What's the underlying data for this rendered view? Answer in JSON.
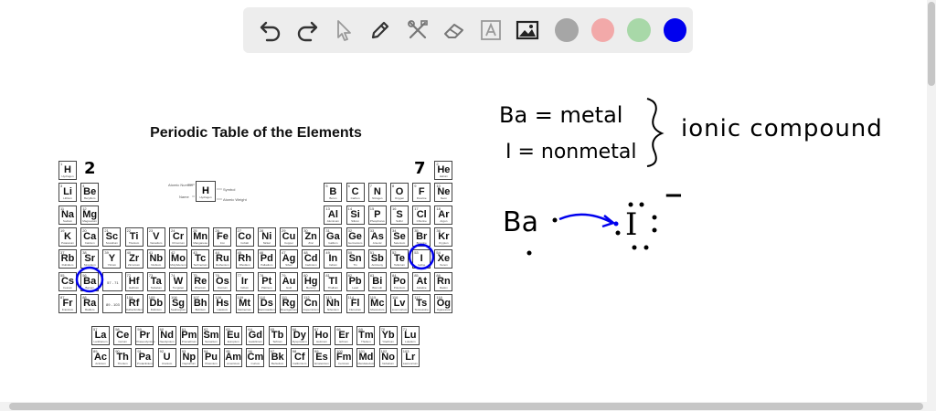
{
  "toolbar": {
    "tools": [
      {
        "name": "undo-button",
        "icon": "undo-icon"
      },
      {
        "name": "redo-button",
        "icon": "redo-icon"
      },
      {
        "name": "select-button",
        "icon": "pointer-icon"
      },
      {
        "name": "pen-button",
        "icon": "pen-icon"
      },
      {
        "name": "tools-button",
        "icon": "tools-icon"
      },
      {
        "name": "eraser-button",
        "icon": "eraser-icon"
      },
      {
        "name": "text-button",
        "icon": "text-icon"
      },
      {
        "name": "image-button",
        "icon": "image-icon"
      }
    ],
    "colors": [
      "#a6a6a6",
      "#f2a9a9",
      "#a8d8a8",
      "#0000ee"
    ]
  },
  "periodic_table": {
    "title": "Periodic Table of the Elements",
    "key": {
      "symbol": "H",
      "name": "Hydrogen",
      "atomic_number_label": "Atomic Number",
      "name_label": "Name",
      "symbol_label": "Symbol",
      "weight_label": "Atomic Weight"
    },
    "elements": [
      {
        "sym": "H",
        "n": "1",
        "nm": "Hydrogen",
        "r": 0,
        "c": 0
      },
      {
        "sym": "He",
        "n": "2",
        "nm": "Helium",
        "r": 0,
        "c": 17
      },
      {
        "sym": "Li",
        "n": "3",
        "nm": "Lithium",
        "r": 1,
        "c": 0
      },
      {
        "sym": "Be",
        "n": "4",
        "nm": "Beryllium",
        "r": 1,
        "c": 1
      },
      {
        "sym": "B",
        "n": "5",
        "nm": "Boron",
        "r": 1,
        "c": 12
      },
      {
        "sym": "C",
        "n": "6",
        "nm": "Carbon",
        "r": 1,
        "c": 13
      },
      {
        "sym": "N",
        "n": "7",
        "nm": "Nitrogen",
        "r": 1,
        "c": 14
      },
      {
        "sym": "O",
        "n": "8",
        "nm": "Oxygen",
        "r": 1,
        "c": 15
      },
      {
        "sym": "F",
        "n": "9",
        "nm": "Fluorine",
        "r": 1,
        "c": 16
      },
      {
        "sym": "Ne",
        "n": "10",
        "nm": "Neon",
        "r": 1,
        "c": 17
      },
      {
        "sym": "Na",
        "n": "11",
        "nm": "Sodium",
        "r": 2,
        "c": 0
      },
      {
        "sym": "Mg",
        "n": "12",
        "nm": "Magnesium",
        "r": 2,
        "c": 1
      },
      {
        "sym": "Al",
        "n": "13",
        "nm": "Aluminum",
        "r": 2,
        "c": 12
      },
      {
        "sym": "Si",
        "n": "14",
        "nm": "Silicon",
        "r": 2,
        "c": 13
      },
      {
        "sym": "P",
        "n": "15",
        "nm": "Phosphorus",
        "r": 2,
        "c": 14
      },
      {
        "sym": "S",
        "n": "16",
        "nm": "Sulfur",
        "r": 2,
        "c": 15
      },
      {
        "sym": "Cl",
        "n": "17",
        "nm": "Chlorine",
        "r": 2,
        "c": 16
      },
      {
        "sym": "Ar",
        "n": "18",
        "nm": "Argon",
        "r": 2,
        "c": 17
      },
      {
        "sym": "K",
        "n": "19",
        "nm": "Potassium",
        "r": 3,
        "c": 0
      },
      {
        "sym": "Ca",
        "n": "20",
        "nm": "Calcium",
        "r": 3,
        "c": 1
      },
      {
        "sym": "Sc",
        "n": "21",
        "nm": "Scandium",
        "r": 3,
        "c": 2
      },
      {
        "sym": "Ti",
        "n": "22",
        "nm": "Titanium",
        "r": 3,
        "c": 3
      },
      {
        "sym": "V",
        "n": "23",
        "nm": "Vanadium",
        "r": 3,
        "c": 4
      },
      {
        "sym": "Cr",
        "n": "24",
        "nm": "Chromium",
        "r": 3,
        "c": 5
      },
      {
        "sym": "Mn",
        "n": "25",
        "nm": "Manganese",
        "r": 3,
        "c": 6
      },
      {
        "sym": "Fe",
        "n": "26",
        "nm": "Iron",
        "r": 3,
        "c": 7
      },
      {
        "sym": "Co",
        "n": "27",
        "nm": "Cobalt",
        "r": 3,
        "c": 8
      },
      {
        "sym": "Ni",
        "n": "28",
        "nm": "Nickel",
        "r": 3,
        "c": 9
      },
      {
        "sym": "Cu",
        "n": "29",
        "nm": "Copper",
        "r": 3,
        "c": 10
      },
      {
        "sym": "Zn",
        "n": "30",
        "nm": "Zinc",
        "r": 3,
        "c": 11
      },
      {
        "sym": "Ga",
        "n": "31",
        "nm": "Gallium",
        "r": 3,
        "c": 12
      },
      {
        "sym": "Ge",
        "n": "32",
        "nm": "Germanium",
        "r": 3,
        "c": 13
      },
      {
        "sym": "As",
        "n": "33",
        "nm": "Arsenic",
        "r": 3,
        "c": 14
      },
      {
        "sym": "Se",
        "n": "34",
        "nm": "Selenium",
        "r": 3,
        "c": 15
      },
      {
        "sym": "Br",
        "n": "35",
        "nm": "Bromine",
        "r": 3,
        "c": 16
      },
      {
        "sym": "Kr",
        "n": "36",
        "nm": "Krypton",
        "r": 3,
        "c": 17
      },
      {
        "sym": "Rb",
        "n": "37",
        "nm": "Rubidium",
        "r": 4,
        "c": 0
      },
      {
        "sym": "Sr",
        "n": "38",
        "nm": "Strontium",
        "r": 4,
        "c": 1
      },
      {
        "sym": "Y",
        "n": "39",
        "nm": "Yttrium",
        "r": 4,
        "c": 2
      },
      {
        "sym": "Zr",
        "n": "40",
        "nm": "Zirconium",
        "r": 4,
        "c": 3
      },
      {
        "sym": "Nb",
        "n": "41",
        "nm": "Niobium",
        "r": 4,
        "c": 4
      },
      {
        "sym": "Mo",
        "n": "42",
        "nm": "Molybdenum",
        "r": 4,
        "c": 5
      },
      {
        "sym": "Tc",
        "n": "43",
        "nm": "Technetium",
        "r": 4,
        "c": 6
      },
      {
        "sym": "Ru",
        "n": "44",
        "nm": "Ruthenium",
        "r": 4,
        "c": 7
      },
      {
        "sym": "Rh",
        "n": "45",
        "nm": "Rhodium",
        "r": 4,
        "c": 8
      },
      {
        "sym": "Pd",
        "n": "46",
        "nm": "Palladium",
        "r": 4,
        "c": 9
      },
      {
        "sym": "Ag",
        "n": "47",
        "nm": "Silver",
        "r": 4,
        "c": 10
      },
      {
        "sym": "Cd",
        "n": "48",
        "nm": "Cadmium",
        "r": 4,
        "c": 11
      },
      {
        "sym": "In",
        "n": "49",
        "nm": "Indium",
        "r": 4,
        "c": 12
      },
      {
        "sym": "Sn",
        "n": "50",
        "nm": "Tin",
        "r": 4,
        "c": 13
      },
      {
        "sym": "Sb",
        "n": "51",
        "nm": "Antimony",
        "r": 4,
        "c": 14
      },
      {
        "sym": "Te",
        "n": "52",
        "nm": "Tellurium",
        "r": 4,
        "c": 15
      },
      {
        "sym": "I",
        "n": "53",
        "nm": "Iodine",
        "r": 4,
        "c": 16
      },
      {
        "sym": "Xe",
        "n": "54",
        "nm": "Xenon",
        "r": 4,
        "c": 17
      },
      {
        "sym": "Cs",
        "n": "55",
        "nm": "Cesium",
        "r": 5,
        "c": 0
      },
      {
        "sym": "Ba",
        "n": "56",
        "nm": "Barium",
        "r": 5,
        "c": 1
      },
      {
        "sym": "Hf",
        "n": "72",
        "nm": "Hafnium",
        "r": 5,
        "c": 3
      },
      {
        "sym": "Ta",
        "n": "73",
        "nm": "Tantalum",
        "r": 5,
        "c": 4
      },
      {
        "sym": "W",
        "n": "74",
        "nm": "Tungsten",
        "r": 5,
        "c": 5
      },
      {
        "sym": "Re",
        "n": "75",
        "nm": "Rhenium",
        "r": 5,
        "c": 6
      },
      {
        "sym": "Os",
        "n": "76",
        "nm": "Osmium",
        "r": 5,
        "c": 7
      },
      {
        "sym": "Ir",
        "n": "77",
        "nm": "Iridium",
        "r": 5,
        "c": 8
      },
      {
        "sym": "Pt",
        "n": "78",
        "nm": "Platinum",
        "r": 5,
        "c": 9
      },
      {
        "sym": "Au",
        "n": "79",
        "nm": "Gold",
        "r": 5,
        "c": 10
      },
      {
        "sym": "Hg",
        "n": "80",
        "nm": "Mercury",
        "r": 5,
        "c": 11
      },
      {
        "sym": "Tl",
        "n": "81",
        "nm": "Thallium",
        "r": 5,
        "c": 12
      },
      {
        "sym": "Pb",
        "n": "82",
        "nm": "Lead",
        "r": 5,
        "c": 13
      },
      {
        "sym": "Bi",
        "n": "83",
        "nm": "Bismuth",
        "r": 5,
        "c": 14
      },
      {
        "sym": "Po",
        "n": "84",
        "nm": "Polonium",
        "r": 5,
        "c": 15
      },
      {
        "sym": "At",
        "n": "85",
        "nm": "Astatine",
        "r": 5,
        "c": 16
      },
      {
        "sym": "Rn",
        "n": "86",
        "nm": "Radon",
        "r": 5,
        "c": 17
      },
      {
        "sym": "Fr",
        "n": "87",
        "nm": "Francium",
        "r": 6,
        "c": 0
      },
      {
        "sym": "Ra",
        "n": "88",
        "nm": "Radium",
        "r": 6,
        "c": 1
      },
      {
        "sym": "Rf",
        "n": "104",
        "nm": "Rutherfordium",
        "r": 6,
        "c": 3
      },
      {
        "sym": "Db",
        "n": "105",
        "nm": "Dubnium",
        "r": 6,
        "c": 4
      },
      {
        "sym": "Sg",
        "n": "106",
        "nm": "Seaborgium",
        "r": 6,
        "c": 5
      },
      {
        "sym": "Bh",
        "n": "107",
        "nm": "Bohrium",
        "r": 6,
        "c": 6
      },
      {
        "sym": "Hs",
        "n": "108",
        "nm": "Hassium",
        "r": 6,
        "c": 7
      },
      {
        "sym": "Mt",
        "n": "109",
        "nm": "Meitnerium",
        "r": 6,
        "c": 8
      },
      {
        "sym": "Ds",
        "n": "110",
        "nm": "Darmstadtium",
        "r": 6,
        "c": 9
      },
      {
        "sym": "Rg",
        "n": "111",
        "nm": "Roentgenium",
        "r": 6,
        "c": 10
      },
      {
        "sym": "Cn",
        "n": "112",
        "nm": "Copernicium",
        "r": 6,
        "c": 11
      },
      {
        "sym": "Nh",
        "n": "113",
        "nm": "Nihonium",
        "r": 6,
        "c": 12
      },
      {
        "sym": "Fl",
        "n": "114",
        "nm": "Flerovium",
        "r": 6,
        "c": 13
      },
      {
        "sym": "Mc",
        "n": "115",
        "nm": "Moscovium",
        "r": 6,
        "c": 14
      },
      {
        "sym": "Lv",
        "n": "116",
        "nm": "Livermorium",
        "r": 6,
        "c": 15
      },
      {
        "sym": "Ts",
        "n": "117",
        "nm": "Tennessine",
        "r": 6,
        "c": 16
      },
      {
        "sym": "Og",
        "n": "118",
        "nm": "Oganesson",
        "r": 6,
        "c": 17
      },
      {
        "sym": "La",
        "n": "57",
        "nm": "Lanthanum",
        "r": 8,
        "c": 0
      },
      {
        "sym": "Ce",
        "n": "58",
        "nm": "Cerium",
        "r": 8,
        "c": 1
      },
      {
        "sym": "Pr",
        "n": "59",
        "nm": "Praseodymium",
        "r": 8,
        "c": 2
      },
      {
        "sym": "Nd",
        "n": "60",
        "nm": "Neodymium",
        "r": 8,
        "c": 3
      },
      {
        "sym": "Pm",
        "n": "61",
        "nm": "Promethium",
        "r": 8,
        "c": 4
      },
      {
        "sym": "Sm",
        "n": "62",
        "nm": "Samarium",
        "r": 8,
        "c": 5
      },
      {
        "sym": "Eu",
        "n": "63",
        "nm": "Europium",
        "r": 8,
        "c": 6
      },
      {
        "sym": "Gd",
        "n": "64",
        "nm": "Gadolinium",
        "r": 8,
        "c": 7
      },
      {
        "sym": "Tb",
        "n": "65",
        "nm": "Terbium",
        "r": 8,
        "c": 8
      },
      {
        "sym": "Dy",
        "n": "66",
        "nm": "Dysprosium",
        "r": 8,
        "c": 9
      },
      {
        "sym": "Ho",
        "n": "67",
        "nm": "Holmium",
        "r": 8,
        "c": 10
      },
      {
        "sym": "Er",
        "n": "68",
        "nm": "Erbium",
        "r": 8,
        "c": 11
      },
      {
        "sym": "Tm",
        "n": "69",
        "nm": "Thulium",
        "r": 8,
        "c": 12
      },
      {
        "sym": "Yb",
        "n": "70",
        "nm": "Ytterbium",
        "r": 8,
        "c": 13
      },
      {
        "sym": "Lu",
        "n": "71",
        "nm": "Lutetium",
        "r": 8,
        "c": 14
      },
      {
        "sym": "Ac",
        "n": "89",
        "nm": "Actinium",
        "r": 9,
        "c": 0
      },
      {
        "sym": "Th",
        "n": "90",
        "nm": "Thorium",
        "r": 9,
        "c": 1
      },
      {
        "sym": "Pa",
        "n": "91",
        "nm": "Protactinium",
        "r": 9,
        "c": 2
      },
      {
        "sym": "U",
        "n": "92",
        "nm": "Uranium",
        "r": 9,
        "c": 3
      },
      {
        "sym": "Np",
        "n": "93",
        "nm": "Neptunium",
        "r": 9,
        "c": 4
      },
      {
        "sym": "Pu",
        "n": "94",
        "nm": "Plutonium",
        "r": 9,
        "c": 5
      },
      {
        "sym": "Am",
        "n": "95",
        "nm": "Americium",
        "r": 9,
        "c": 6
      },
      {
        "sym": "Cm",
        "n": "96",
        "nm": "Curium",
        "r": 9,
        "c": 7
      },
      {
        "sym": "Bk",
        "n": "97",
        "nm": "Berkelium",
        "r": 9,
        "c": 8
      },
      {
        "sym": "Cf",
        "n": "98",
        "nm": "Californium",
        "r": 9,
        "c": 9
      },
      {
        "sym": "Es",
        "n": "99",
        "nm": "Einsteinium",
        "r": 9,
        "c": 10
      },
      {
        "sym": "Fm",
        "n": "100",
        "nm": "Fermium",
        "r": 9,
        "c": 11
      },
      {
        "sym": "Md",
        "n": "101",
        "nm": "Mendelevium",
        "r": 9,
        "c": 12
      },
      {
        "sym": "No",
        "n": "102",
        "nm": "Nobelium",
        "r": 9,
        "c": 13
      },
      {
        "sym": "Lr",
        "n": "103",
        "nm": "Lawrencium",
        "r": 9,
        "c": 14
      }
    ],
    "placeholders": [
      {
        "text": "57 - 71",
        "r": 5
      },
      {
        "text": "89 - 103",
        "r": 6
      }
    ]
  },
  "annotations": {
    "group2": "2",
    "group7": "7",
    "ba_line": "Ba = metal",
    "i_line": "I = nonmetal",
    "conclusion": "ionic compound",
    "ba_symbol": "Ba",
    "i_symbol": "I",
    "charge": "−",
    "ink_color": "#0000ee",
    "marker_color": "#000000"
  }
}
